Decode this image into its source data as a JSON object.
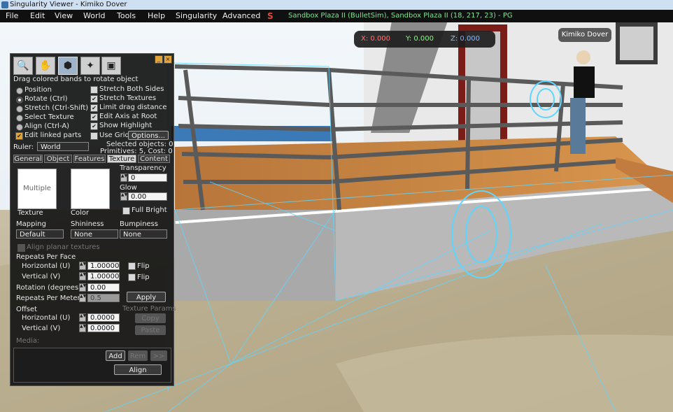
{
  "window": {
    "title": "Singularity Viewer - Kimiko Dover"
  },
  "menu": {
    "items": [
      "File",
      "Edit",
      "View",
      "World",
      "Tools",
      "Help",
      "Singularity",
      "Advanced"
    ],
    "location": "Sandbox Plaza II (BulletSim), Sandbox Plaza II (18, 217, 23) - PG"
  },
  "coords": {
    "x": "X: 0.000",
    "y": "Y: 0.000",
    "z": "Z: 0.000"
  },
  "avatar": {
    "name": "Kimiko Dover"
  },
  "build": {
    "hint": "Drag colored bands to rotate object",
    "modes": [
      "Position",
      "Rotate (Ctrl)",
      "Stretch (Ctrl-Shift)",
      "Select Texture",
      "Align (Ctrl-A)"
    ],
    "selected_mode": 1,
    "options": [
      {
        "label": "Stretch Both Sides",
        "checked": false
      },
      {
        "label": "Stretch Textures",
        "checked": true
      },
      {
        "label": "Limit drag distance",
        "checked": true
      },
      {
        "label": "Edit Axis at Root",
        "checked": true
      },
      {
        "label": "Show Highlight",
        "checked": true
      },
      {
        "label": "Use Grid",
        "checked": false
      }
    ],
    "edit_linked": "Edit linked parts",
    "options_button": "Options...",
    "ruler_label": "Ruler:",
    "ruler_value": "World",
    "selected_objects": "Selected objects: 0",
    "primitives": "Primitives: 5, Cost: 0",
    "tabs": [
      "General",
      "Object",
      "Features",
      "Texture",
      "Content"
    ],
    "active_tab": "Texture"
  },
  "texture": {
    "texture_label": "Texture",
    "texture_value": "Multiple",
    "color_label": "Color",
    "transparency_label": "Transparency",
    "transparency_value": "0",
    "glow_label": "Glow",
    "glow_value": "0.00",
    "full_bright": "Full Bright",
    "mapping_label": "Mapping",
    "mapping_value": "Default",
    "shininess_label": "Shininess",
    "shininess_value": "None",
    "bumpiness_label": "Bumpiness",
    "bumpiness_value": "None",
    "align_planar": "Align planar textures",
    "repeats_label": "Repeats Per Face",
    "horizontal_u": "Horizontal (U)",
    "horizontal_u_value": "1.00000",
    "vertical_v": "Vertical (V)",
    "vertical_v_value": "1.00000",
    "flip": "Flip",
    "rotation_label": "Rotation (degrees)",
    "rotation_value": "0.00",
    "repeats_meter_label": "Repeats Per Meter",
    "repeats_meter_value": "0.5",
    "apply": "Apply",
    "texture_params": "Texture Params",
    "copy": "Copy",
    "paste": "Paste",
    "offset_label": "Offset",
    "offset_h_value": "0.0000",
    "offset_v_value": "0.0000",
    "media_label": "Media:",
    "add": "Add",
    "remove": "Rem",
    "more": ">>",
    "align": "Align"
  },
  "colors": {
    "titlebar": "#cfe0f3",
    "menubar": "#101010",
    "panel": "#161616",
    "accent_orange": "#e0a43a",
    "location_green": "#7fe39a",
    "wireframe": "#5fd6ff"
  }
}
